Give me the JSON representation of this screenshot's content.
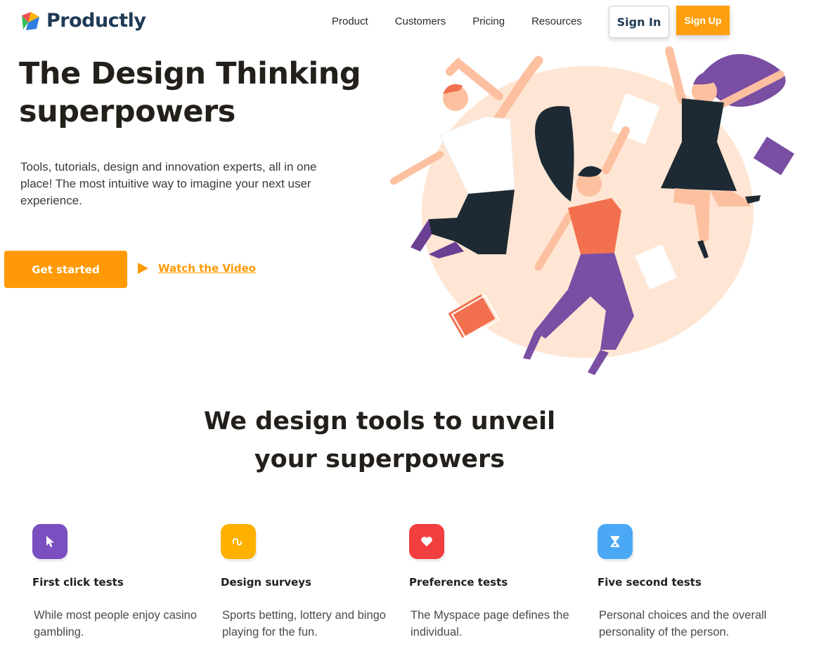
{
  "brand": {
    "name": "Productly"
  },
  "nav": {
    "items": [
      {
        "label": "Product"
      },
      {
        "label": "Customers"
      },
      {
        "label": "Pricing"
      },
      {
        "label": "Resources"
      }
    ],
    "signin_label": "Sign In",
    "signup_label": "Sign Up"
  },
  "hero": {
    "title_line1": "The Design Thinking",
    "title_line2": "superpowers",
    "subtitle": "Tools, tutorials, design and innovation experts, all in one place! The most intuitive way to imagine your next user experience.",
    "cta_label": "Get started",
    "video_label": "Watch the Video"
  },
  "section": {
    "title_line1": "We design tools to unveil",
    "title_line2": "your superpowers"
  },
  "features": [
    {
      "icon": "cursor-icon",
      "color": "#7b4fc0",
      "title": "First click tests",
      "desc": "While most people enjoy casino gambling."
    },
    {
      "icon": "stumbleupon-icon",
      "color": "#ffb000",
      "title": "Design surveys",
      "desc": "Sports betting, lottery and bingo playing for the fun."
    },
    {
      "icon": "heart-icon",
      "color": "#f13e3e",
      "title": "Preference tests",
      "desc": "The Myspace page defines the individual."
    },
    {
      "icon": "hourglass-icon",
      "color": "#4aa8f5",
      "title": "Five second tests",
      "desc": "Personal choices and the overall personality of the person."
    }
  ],
  "colors": {
    "accent": "#ff9a06",
    "brand_text": "#1e3a55",
    "heading": "#231f1a",
    "blob": "#ffe6d4"
  }
}
